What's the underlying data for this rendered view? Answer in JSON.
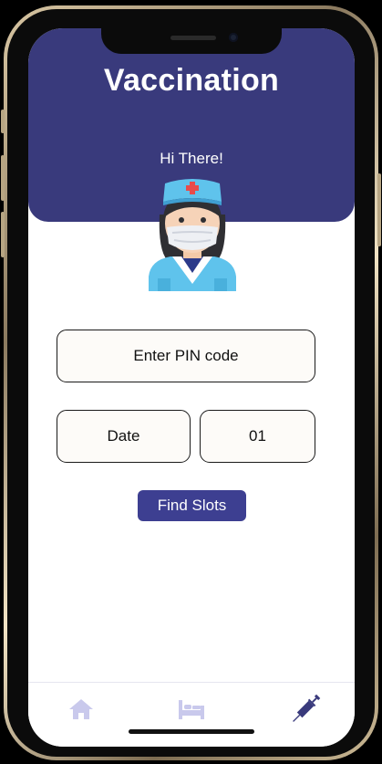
{
  "app": {
    "title": "Vaccination",
    "greeting": "Hi There!"
  },
  "form": {
    "pin_placeholder": "Enter PIN code",
    "date_label": "Date",
    "day_value": "01",
    "find_button": "Find Slots"
  },
  "tabs": [
    {
      "icon": "home-icon",
      "selected": false
    },
    {
      "icon": "bed-icon",
      "selected": false
    },
    {
      "icon": "syringe-icon",
      "selected": true
    }
  ],
  "colors": {
    "primary": "#393a7c",
    "button": "#3d3f91",
    "tab_inactive": "#c9c9ec",
    "tab_active": "#393a7c"
  }
}
